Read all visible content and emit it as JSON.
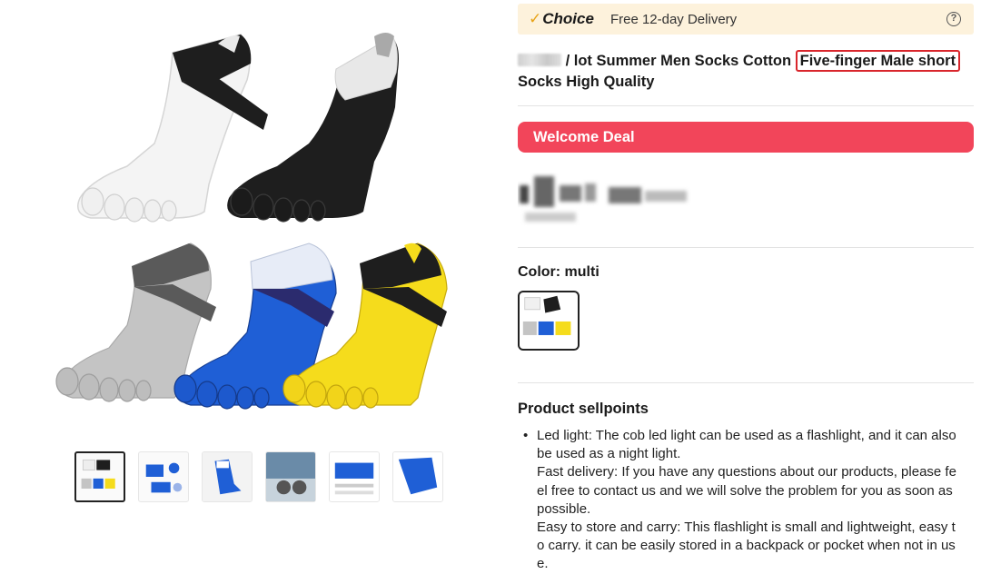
{
  "choice_bar": {
    "badge": "Choice",
    "check_glyph": "✓",
    "delivery": "Free 12-day Delivery",
    "help_glyph": "?"
  },
  "product": {
    "title_main": " / lot Summer Men Socks Cotton ",
    "title_highlight": "Five-finger Male short",
    "title_tail": "Socks High Quality"
  },
  "deal": {
    "label": "Welcome Deal"
  },
  "color": {
    "label": "Color: multi",
    "selected": "multi"
  },
  "sellpoints": {
    "title": "Product sellpoints",
    "lines": [
      "Led light: The cob led light can be used as a flashlight, and it can also",
      "be used as a night light.",
      "Fast delivery: If you have any questions about our products, please fe",
      "el free to contact us and we will solve the problem for you as soon as",
      "possible.",
      "Easy to store and carry: This flashlight is small and lightweight, easy t",
      "o carry. it can be easily stored in a backpack or pocket when not in us",
      "e."
    ]
  },
  "gallery": {
    "thumbnail_count": 6,
    "selected_index": 0
  },
  "colors": {
    "choice_bg": "#fdf2dc",
    "choice_check": "#e8a317",
    "welcome_bg": "#f2455a",
    "highlight_border": "#d9262c",
    "sock_white": "#f4f4f4",
    "sock_black": "#1e1e1e",
    "sock_gray": "#c4c4c4",
    "sock_blue": "#1f5fd6",
    "sock_yellow": "#f5dc1c"
  },
  "icons": {
    "help": "question-circle-icon",
    "choice": "checkmark-icon"
  }
}
